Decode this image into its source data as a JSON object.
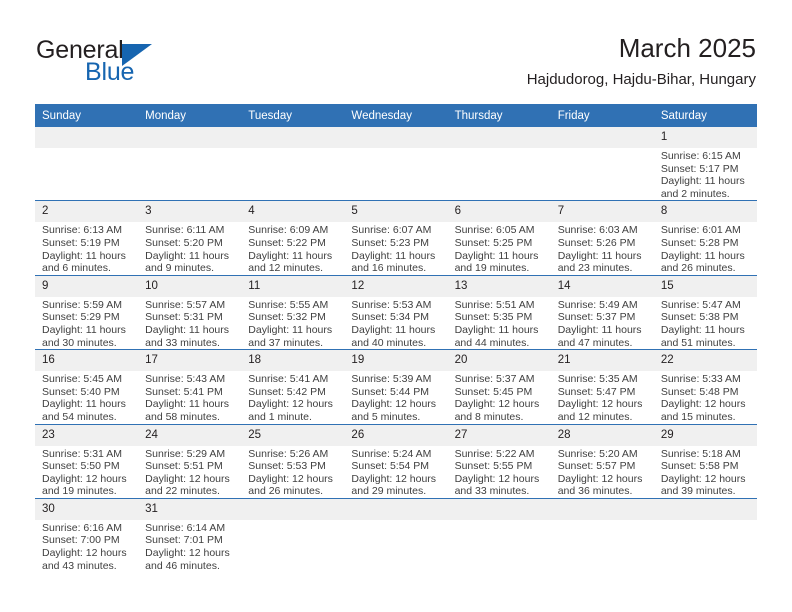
{
  "brand": {
    "name_part1": "General",
    "name_part2": "Blue",
    "logo_icon": "triangle-logo-icon"
  },
  "header": {
    "title": "March 2025",
    "location": "Hajdudorog, Hajdu-Bihar, Hungary"
  },
  "calendar": {
    "accent_color": "#3071b4",
    "daynum_bg": "#f0f0f0",
    "weekdays": [
      "Sunday",
      "Monday",
      "Tuesday",
      "Wednesday",
      "Thursday",
      "Friday",
      "Saturday"
    ],
    "weeks": [
      [
        {
          "day": "",
          "blank": true
        },
        {
          "day": "",
          "blank": true
        },
        {
          "day": "",
          "blank": true
        },
        {
          "day": "",
          "blank": true
        },
        {
          "day": "",
          "blank": true
        },
        {
          "day": "",
          "blank": true
        },
        {
          "day": "1",
          "sunrise": "Sunrise: 6:15 AM",
          "sunset": "Sunset: 5:17 PM",
          "daylight": "Daylight: 11 hours and 2 minutes."
        }
      ],
      [
        {
          "day": "2",
          "sunrise": "Sunrise: 6:13 AM",
          "sunset": "Sunset: 5:19 PM",
          "daylight": "Daylight: 11 hours and 6 minutes."
        },
        {
          "day": "3",
          "sunrise": "Sunrise: 6:11 AM",
          "sunset": "Sunset: 5:20 PM",
          "daylight": "Daylight: 11 hours and 9 minutes."
        },
        {
          "day": "4",
          "sunrise": "Sunrise: 6:09 AM",
          "sunset": "Sunset: 5:22 PM",
          "daylight": "Daylight: 11 hours and 12 minutes."
        },
        {
          "day": "5",
          "sunrise": "Sunrise: 6:07 AM",
          "sunset": "Sunset: 5:23 PM",
          "daylight": "Daylight: 11 hours and 16 minutes."
        },
        {
          "day": "6",
          "sunrise": "Sunrise: 6:05 AM",
          "sunset": "Sunset: 5:25 PM",
          "daylight": "Daylight: 11 hours and 19 minutes."
        },
        {
          "day": "7",
          "sunrise": "Sunrise: 6:03 AM",
          "sunset": "Sunset: 5:26 PM",
          "daylight": "Daylight: 11 hours and 23 minutes."
        },
        {
          "day": "8",
          "sunrise": "Sunrise: 6:01 AM",
          "sunset": "Sunset: 5:28 PM",
          "daylight": "Daylight: 11 hours and 26 minutes."
        }
      ],
      [
        {
          "day": "9",
          "sunrise": "Sunrise: 5:59 AM",
          "sunset": "Sunset: 5:29 PM",
          "daylight": "Daylight: 11 hours and 30 minutes."
        },
        {
          "day": "10",
          "sunrise": "Sunrise: 5:57 AM",
          "sunset": "Sunset: 5:31 PM",
          "daylight": "Daylight: 11 hours and 33 minutes."
        },
        {
          "day": "11",
          "sunrise": "Sunrise: 5:55 AM",
          "sunset": "Sunset: 5:32 PM",
          "daylight": "Daylight: 11 hours and 37 minutes."
        },
        {
          "day": "12",
          "sunrise": "Sunrise: 5:53 AM",
          "sunset": "Sunset: 5:34 PM",
          "daylight": "Daylight: 11 hours and 40 minutes."
        },
        {
          "day": "13",
          "sunrise": "Sunrise: 5:51 AM",
          "sunset": "Sunset: 5:35 PM",
          "daylight": "Daylight: 11 hours and 44 minutes."
        },
        {
          "day": "14",
          "sunrise": "Sunrise: 5:49 AM",
          "sunset": "Sunset: 5:37 PM",
          "daylight": "Daylight: 11 hours and 47 minutes."
        },
        {
          "day": "15",
          "sunrise": "Sunrise: 5:47 AM",
          "sunset": "Sunset: 5:38 PM",
          "daylight": "Daylight: 11 hours and 51 minutes."
        }
      ],
      [
        {
          "day": "16",
          "sunrise": "Sunrise: 5:45 AM",
          "sunset": "Sunset: 5:40 PM",
          "daylight": "Daylight: 11 hours and 54 minutes."
        },
        {
          "day": "17",
          "sunrise": "Sunrise: 5:43 AM",
          "sunset": "Sunset: 5:41 PM",
          "daylight": "Daylight: 11 hours and 58 minutes."
        },
        {
          "day": "18",
          "sunrise": "Sunrise: 5:41 AM",
          "sunset": "Sunset: 5:42 PM",
          "daylight": "Daylight: 12 hours and 1 minute."
        },
        {
          "day": "19",
          "sunrise": "Sunrise: 5:39 AM",
          "sunset": "Sunset: 5:44 PM",
          "daylight": "Daylight: 12 hours and 5 minutes."
        },
        {
          "day": "20",
          "sunrise": "Sunrise: 5:37 AM",
          "sunset": "Sunset: 5:45 PM",
          "daylight": "Daylight: 12 hours and 8 minutes."
        },
        {
          "day": "21",
          "sunrise": "Sunrise: 5:35 AM",
          "sunset": "Sunset: 5:47 PM",
          "daylight": "Daylight: 12 hours and 12 minutes."
        },
        {
          "day": "22",
          "sunrise": "Sunrise: 5:33 AM",
          "sunset": "Sunset: 5:48 PM",
          "daylight": "Daylight: 12 hours and 15 minutes."
        }
      ],
      [
        {
          "day": "23",
          "sunrise": "Sunrise: 5:31 AM",
          "sunset": "Sunset: 5:50 PM",
          "daylight": "Daylight: 12 hours and 19 minutes."
        },
        {
          "day": "24",
          "sunrise": "Sunrise: 5:29 AM",
          "sunset": "Sunset: 5:51 PM",
          "daylight": "Daylight: 12 hours and 22 minutes."
        },
        {
          "day": "25",
          "sunrise": "Sunrise: 5:26 AM",
          "sunset": "Sunset: 5:53 PM",
          "daylight": "Daylight: 12 hours and 26 minutes."
        },
        {
          "day": "26",
          "sunrise": "Sunrise: 5:24 AM",
          "sunset": "Sunset: 5:54 PM",
          "daylight": "Daylight: 12 hours and 29 minutes."
        },
        {
          "day": "27",
          "sunrise": "Sunrise: 5:22 AM",
          "sunset": "Sunset: 5:55 PM",
          "daylight": "Daylight: 12 hours and 33 minutes."
        },
        {
          "day": "28",
          "sunrise": "Sunrise: 5:20 AM",
          "sunset": "Sunset: 5:57 PM",
          "daylight": "Daylight: 12 hours and 36 minutes."
        },
        {
          "day": "29",
          "sunrise": "Sunrise: 5:18 AM",
          "sunset": "Sunset: 5:58 PM",
          "daylight": "Daylight: 12 hours and 39 minutes."
        }
      ],
      [
        {
          "day": "30",
          "sunrise": "Sunrise: 6:16 AM",
          "sunset": "Sunset: 7:00 PM",
          "daylight": "Daylight: 12 hours and 43 minutes."
        },
        {
          "day": "31",
          "sunrise": "Sunrise: 6:14 AM",
          "sunset": "Sunset: 7:01 PM",
          "daylight": "Daylight: 12 hours and 46 minutes."
        },
        {
          "day": "",
          "blank": true
        },
        {
          "day": "",
          "blank": true
        },
        {
          "day": "",
          "blank": true
        },
        {
          "day": "",
          "blank": true
        },
        {
          "day": "",
          "blank": true
        }
      ]
    ]
  }
}
